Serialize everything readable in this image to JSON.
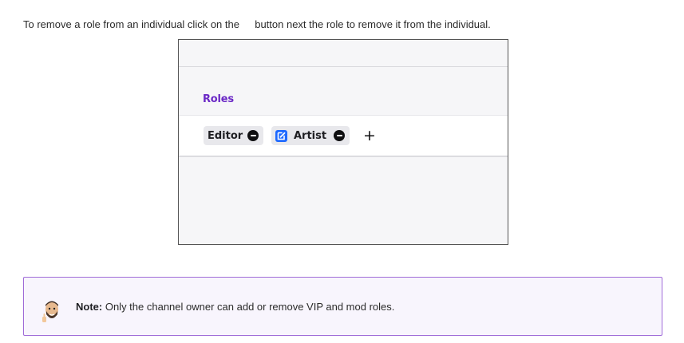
{
  "intro": {
    "before": "To remove a role from an individual click on the",
    "after": "button next the role to remove it from the individual."
  },
  "panel": {
    "roles_label": "Roles",
    "chips": [
      {
        "label": "Editor",
        "badge": null
      },
      {
        "label": "Artist",
        "badge": "artist-badge-icon"
      }
    ],
    "add_icon": "plus-icon",
    "remove_icon": "minus-circle-icon"
  },
  "note": {
    "label": "Note:",
    "text": "Only the channel owner can add or remove VIP and mod roles.",
    "icon": "avatar-thumbs-up-icon"
  },
  "colors": {
    "roles_label": "#6b29c6",
    "note_border": "#9f6bd8",
    "artist_badge": "#1e69ff"
  }
}
